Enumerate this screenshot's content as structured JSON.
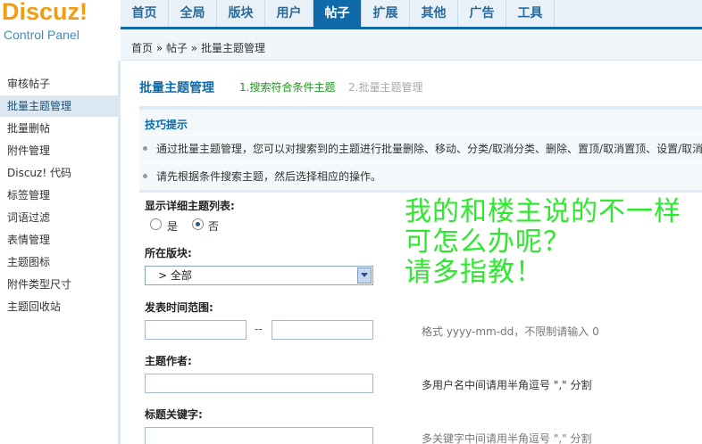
{
  "logo": {
    "title": "Discuz",
    "excl": "!",
    "subtitle": "Control Panel"
  },
  "nav": {
    "items": [
      {
        "label": "首页"
      },
      {
        "label": "全局"
      },
      {
        "label": "版块"
      },
      {
        "label": "用户"
      },
      {
        "label": "帖子",
        "active": true
      },
      {
        "label": "扩展"
      },
      {
        "label": "其他"
      },
      {
        "label": "广告"
      },
      {
        "label": "工具"
      }
    ]
  },
  "breadcrumb": "首页 » 帖子 » 批量主题管理",
  "sidebar": {
    "items": [
      {
        "label": "审核帖子"
      },
      {
        "label": "批量主题管理",
        "active": true
      },
      {
        "label": "批量删帖"
      },
      {
        "label": "附件管理"
      },
      {
        "label": "Discuz! 代码"
      },
      {
        "label": "标签管理"
      },
      {
        "label": "词语过滤"
      },
      {
        "label": "表情管理"
      },
      {
        "label": "主题图标"
      },
      {
        "label": "附件类型尺寸"
      },
      {
        "label": "主题回收站"
      }
    ]
  },
  "main": {
    "title": "批量主题管理",
    "step1": "1.搜索符合条件主题",
    "step2": "2.批量主题管理",
    "tips": {
      "title": "技巧提示",
      "line1": "通过批量主题管理，您可以对搜索到的主题进行批量删除、移动、分类/取消分类、删除、置顶/取消置顶、设置/取消",
      "line2": "请先根据条件搜索主题，然后选择相应的操作。"
    },
    "detail_label": "显示详细主题列表:",
    "radio_yes": "是",
    "radio_no": "否",
    "forum_label": "所在版块:",
    "forum_value": "> 全部",
    "date_label": "发表时间范围:",
    "date_sep": "--",
    "date_hint": "格式 yyyy-mm-dd，不限制请输入 0",
    "author_label": "主题作者:",
    "author_hint": "多用户名中间请用半角逗号 \",\" 分割",
    "keyword_label": "标题关键字:",
    "keyword_hint": "多关键字中间请用半角逗号 \",\" 分割"
  },
  "overlay": {
    "line1": "我的和楼主说的不一样",
    "line2": "可怎么办呢？",
    "line3": "请多指教！"
  },
  "colors": {
    "accent": "#0e6aa8",
    "overlay": "#2ee82e",
    "logo": "#f39c12"
  }
}
